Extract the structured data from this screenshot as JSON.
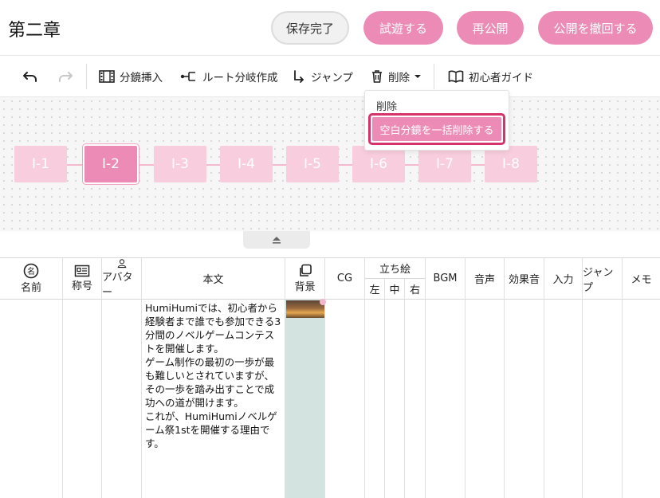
{
  "header": {
    "title": "第二章",
    "saved_label": "保存完了",
    "play_label": "試遊する",
    "republish_label": "再公開",
    "unpublish_label": "公開を撤回する"
  },
  "toolbar": {
    "insert_label": "分鏡挿入",
    "branch_label": "ルート分岐作成",
    "jump_label": "ジャンプ",
    "delete_label": "削除",
    "guide_label": "初心者ガイド"
  },
  "delete_menu": {
    "delete_label": "削除",
    "bulk_delete_label": "空白分鏡を一括削除する"
  },
  "nodes": [
    "I-1",
    "I-2",
    "I-3",
    "I-4",
    "I-5",
    "I-6",
    "I-7",
    "I-8"
  ],
  "active_node": "I-2",
  "columns": {
    "name": "名前",
    "title": "称号",
    "avatar": "アバター",
    "body": "本文",
    "background": "背景",
    "cg": "CG",
    "standing": "立ち絵",
    "left": "左",
    "center": "中",
    "right": "右",
    "bgm": "BGM",
    "voice": "音声",
    "sfx": "効果音",
    "input": "入力",
    "jump": "ジャンプ",
    "memo": "メモ"
  },
  "row": {
    "body_text": "HumiHumiでは、初心者から経験者まで誰でも参加できる3分間のノベルゲームコンテストを開催します。\nゲーム制作の最初の一歩が最も難しいとされていますが、その一歩を踏み出すことで成功への道が開けます。\nこれが、HumiHumiノベルゲーム祭1stを開催する理由です。"
  },
  "colors": {
    "accent_pink": "#ec8cb6",
    "node_pink_light": "#f8cddd",
    "highlight_border": "#d6336c",
    "background_column": "#d3e3df"
  }
}
